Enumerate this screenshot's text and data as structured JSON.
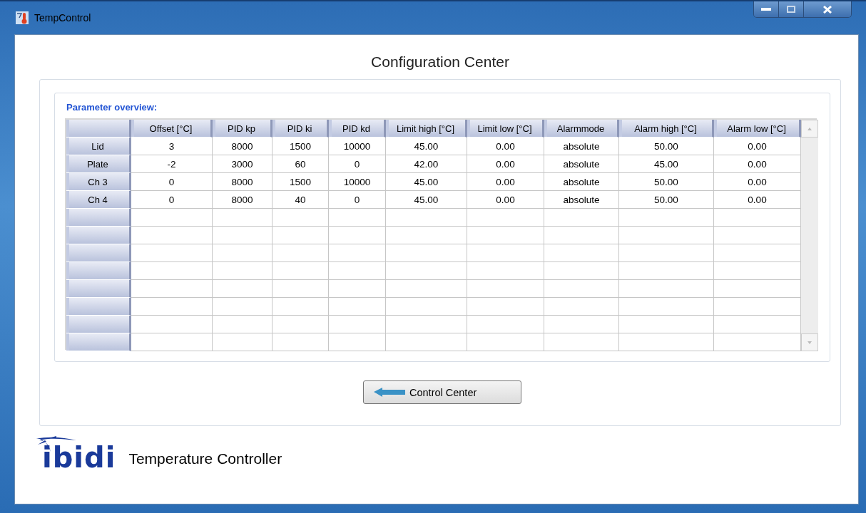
{
  "window": {
    "title": "TempControl"
  },
  "heading": "Configuration Center",
  "table": {
    "caption": "Parameter overview:",
    "columns": [
      "Offset [°C]",
      "PID kp",
      "PID ki",
      "PID kd",
      "Limit high [°C]",
      "Limit low [°C]",
      "Alarmmode",
      "Alarm high [°C]",
      "Alarm low [°C]"
    ],
    "rows": [
      {
        "label": "Lid",
        "cells": [
          "3",
          "8000",
          "1500",
          "10000",
          "45.00",
          "0.00",
          "absolute",
          "50.00",
          "0.00"
        ]
      },
      {
        "label": "Plate",
        "cells": [
          "-2",
          "3000",
          "60",
          "0",
          "42.00",
          "0.00",
          "absolute",
          "45.00",
          "0.00"
        ]
      },
      {
        "label": "Ch 3",
        "cells": [
          "0",
          "8000",
          "1500",
          "10000",
          "45.00",
          "0.00",
          "absolute",
          "50.00",
          "0.00"
        ]
      },
      {
        "label": "Ch 4",
        "cells": [
          "0",
          "8000",
          "40",
          "0",
          "45.00",
          "0.00",
          "absolute",
          "50.00",
          "0.00"
        ]
      }
    ]
  },
  "button": "Control Center",
  "footer": {
    "logo": "ibidi",
    "title": "Temperature Controller"
  }
}
